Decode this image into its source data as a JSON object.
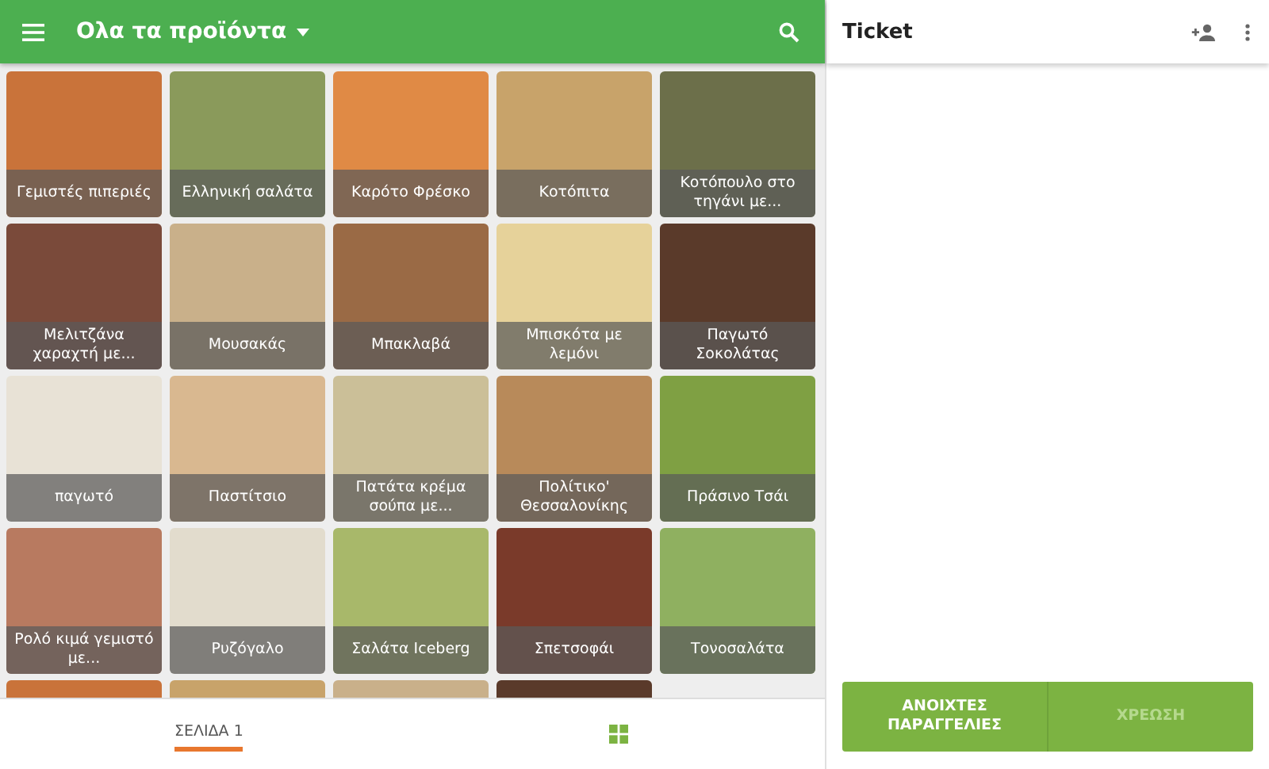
{
  "top_bar": {
    "title": "Ολα τα προϊόντα"
  },
  "products": [
    {
      "kind": "tile",
      "name": "Γεμιστές πιπεριές"
    },
    {
      "kind": "tile",
      "name": "Ελληνική σαλάτα"
    },
    {
      "kind": "tile",
      "name": "Καρότο Φρέσκο"
    },
    {
      "kind": "tile",
      "name": "Κοτόπιτα"
    },
    {
      "kind": "tile",
      "name": "Κοτόπουλο στο τηγάνι με..."
    },
    {
      "kind": "tile",
      "name": "Μελιτζάνα χαραχτή με..."
    },
    {
      "kind": "tile",
      "name": "Μουσακάς"
    },
    {
      "kind": "tile",
      "name": "Μπακλαβά"
    },
    {
      "kind": "tile",
      "name": "Μπισκότα με λεμόνι"
    },
    {
      "kind": "tile",
      "name": "Παγωτό Σοκολάτας"
    },
    {
      "kind": "tile",
      "name": "παγωτό"
    },
    {
      "kind": "tile",
      "name": "Παστίτσιο"
    },
    {
      "kind": "tile",
      "name": "Πατάτα κρέμα σούπα με..."
    },
    {
      "kind": "tile",
      "name": "Πολίτικο' Θεσσαλονίκης"
    },
    {
      "kind": "tile",
      "name": "Πράσινο Τσάι"
    },
    {
      "kind": "tile",
      "name": "Ρολό κιμά γεμιστό με..."
    },
    {
      "kind": "tile",
      "name": "Ρυζόγαλο"
    },
    {
      "kind": "tile",
      "name": "Σαλάτα Iceberg"
    },
    {
      "kind": "tile",
      "name": "Σπετσοφάι"
    },
    {
      "kind": "tile",
      "name": "Τονοσαλάτα"
    },
    {
      "kind": "partial"
    },
    {
      "kind": "partial"
    },
    {
      "kind": "partial"
    },
    {
      "kind": "partial"
    }
  ],
  "pages": [
    {
      "label": "ΣΕΛΙΔΑ 1",
      "selected": true
    }
  ],
  "ticket": {
    "title": "Ticket"
  },
  "buttons": [
    {
      "label": "ΑΝΟΙΧΤΕΣ ΠΑΡΑΓΓΕΛΙΕΣ",
      "disabled": false
    },
    {
      "label": "ΧΡΕΩΣΗ",
      "disabled": true
    }
  ]
}
